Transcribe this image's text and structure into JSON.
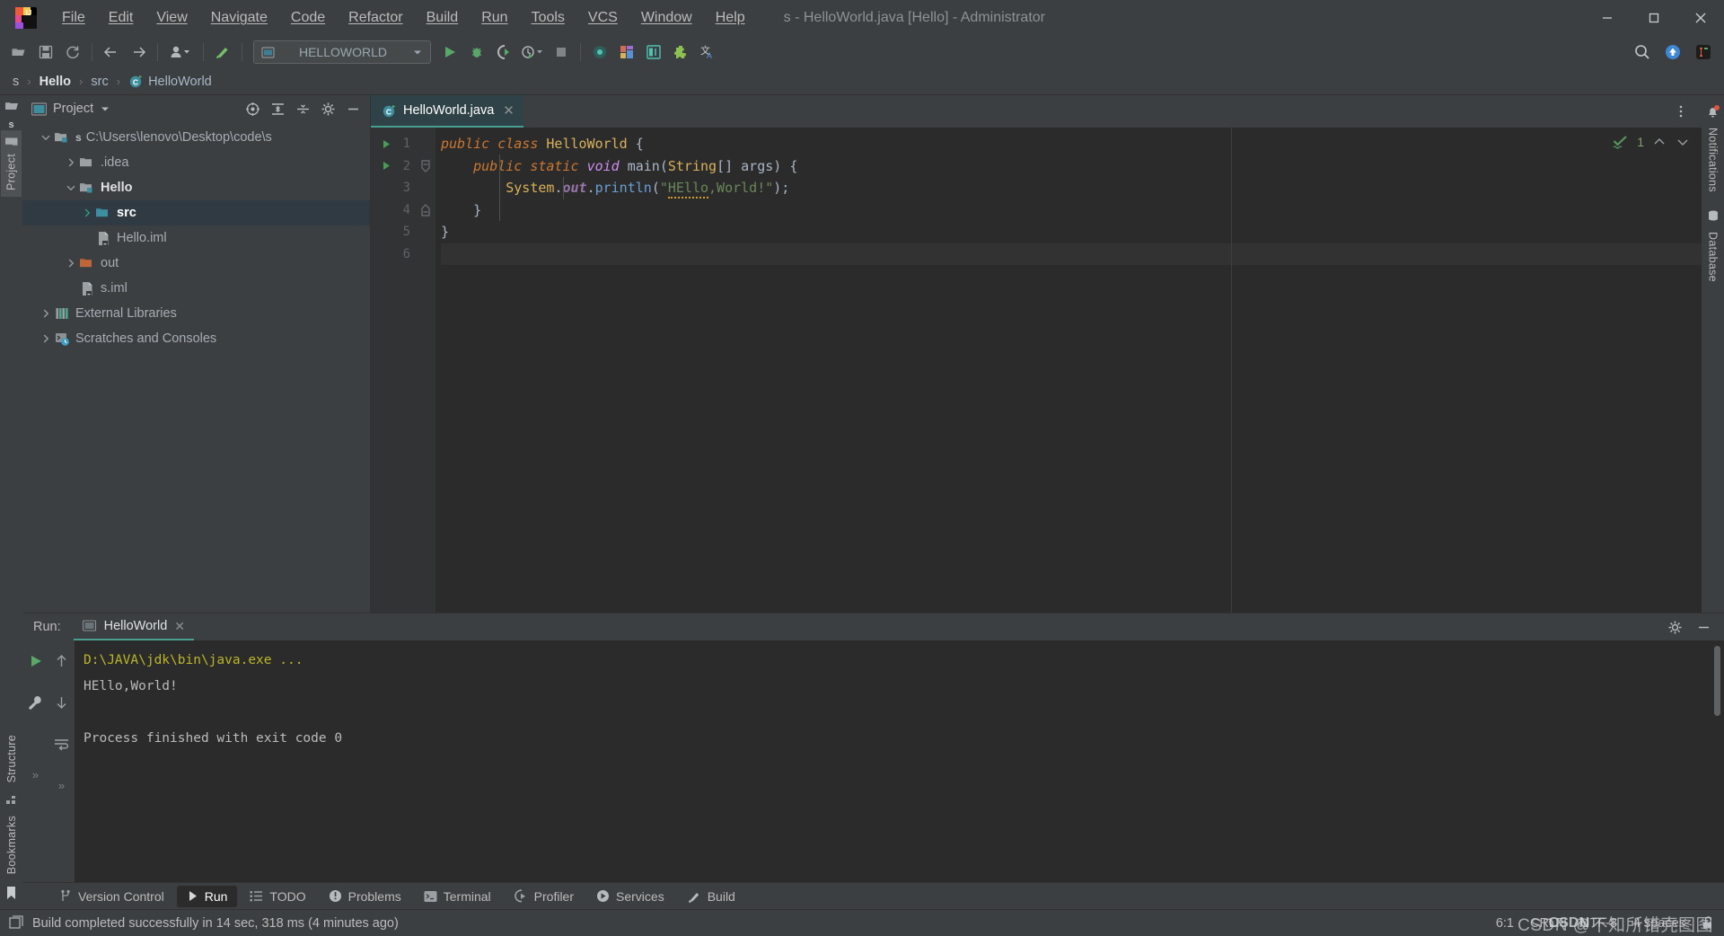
{
  "window": {
    "title": "s - HelloWorld.java [Hello] - Administrator",
    "controls": {
      "minimize": "—",
      "maximize": "❐",
      "close": "✕"
    }
  },
  "menu": {
    "items": [
      {
        "label": "File",
        "mnemonic": "F"
      },
      {
        "label": "Edit",
        "mnemonic": "E"
      },
      {
        "label": "View",
        "mnemonic": "V"
      },
      {
        "label": "Navigate",
        "mnemonic": "N"
      },
      {
        "label": "Code",
        "mnemonic": "C"
      },
      {
        "label": "Refactor",
        "mnemonic": "R"
      },
      {
        "label": "Build",
        "mnemonic": "B"
      },
      {
        "label": "Run",
        "mnemonic": "u"
      },
      {
        "label": "Tools",
        "mnemonic": "T"
      },
      {
        "label": "VCS",
        "mnemonic": "S"
      },
      {
        "label": "Window",
        "mnemonic": "W"
      },
      {
        "label": "Help",
        "mnemonic": "H"
      }
    ]
  },
  "toolbar": {
    "icons": [
      "open-folder-icon",
      "save-all-icon",
      "sync-refresh-icon",
      "navigate-back-icon",
      "navigate-forward-icon",
      "user-account-icon",
      "build-hammer-icon"
    ],
    "run_configuration": "HELLOWORLD",
    "run_config_icon": "module-icon",
    "run_icon": "run-play-icon",
    "debug_icon": "debug-bug-icon",
    "run_coverage_icon": "run-with-coverage-icon",
    "profiler_icon": "profile-clock-icon",
    "stop_icon": "stop-square-icon",
    "right_icons": [
      "search-everywhere-icon",
      "update-arrow-icon",
      "ide-launch-icon"
    ],
    "extra_icons": [
      "database-dot-icon",
      "layout-blocks-icon",
      "inspect-icon",
      "plugin-puzzle-icon",
      "translate-icon"
    ]
  },
  "breadcrumb": {
    "items": [
      {
        "label": "s",
        "type": "project"
      },
      {
        "label": "Hello",
        "type": "module"
      },
      {
        "label": "src",
        "type": "folder"
      },
      {
        "label": "HelloWorld",
        "type": "class"
      }
    ],
    "separator": "›"
  },
  "left_rail": {
    "top_icons": [
      "open-file-icon",
      "project-s-icon"
    ],
    "tabs": [
      {
        "label": "Project",
        "icon": "project-window-icon",
        "active": true
      }
    ],
    "bottom_tabs": [
      {
        "label": "Structure",
        "icon": "structure-icon"
      },
      {
        "label": "Bookmarks",
        "icon": "bookmark-icon"
      }
    ]
  },
  "right_rail": {
    "tabs": [
      {
        "label": "Notifications",
        "icon": "bell-notification-icon",
        "badge": true
      },
      {
        "label": "Database",
        "icon": "database-icon"
      }
    ]
  },
  "project_panel": {
    "title": "Project",
    "title_icon": "project-window-icon",
    "dropdown_icon": "chevron-down-icon",
    "header_actions": [
      "select-opened-file-icon",
      "expand-all-icon",
      "collapse-all-icon",
      "settings-gear-icon",
      "hide-minus-icon"
    ],
    "tree": [
      {
        "label": "C:\\Users\\lenovo\\Desktop\\code\\s",
        "prefix": "s",
        "depth": 0,
        "expanded": true,
        "icon": "module-folder-icon",
        "selected": false,
        "style": "normal"
      },
      {
        "label": ".idea",
        "depth": 1,
        "expanded": false,
        "icon": "folder-icon",
        "selected": false,
        "style": "normal"
      },
      {
        "label": "Hello",
        "depth": 1,
        "expanded": true,
        "icon": "module-folder-icon",
        "selected": false,
        "style": "bold"
      },
      {
        "label": "src",
        "depth": 2,
        "expanded": false,
        "icon": "source-folder-icon",
        "selected": true,
        "style": "white"
      },
      {
        "label": "Hello.iml",
        "depth": 2,
        "expanded": null,
        "icon": "iml-file-icon",
        "selected": false,
        "style": "normal"
      },
      {
        "label": "out",
        "depth": 1,
        "expanded": false,
        "icon": "excluded-folder-icon",
        "selected": false,
        "style": "normal"
      },
      {
        "label": "s.iml",
        "depth": 1,
        "expanded": null,
        "icon": "iml-file-icon",
        "selected": false,
        "style": "normal"
      },
      {
        "label": "External Libraries",
        "depth": 0,
        "expanded": false,
        "icon": "libraries-icon",
        "selected": false,
        "style": "normal"
      },
      {
        "label": "Scratches and Consoles",
        "depth": 0,
        "expanded": false,
        "icon": "scratches-icon",
        "selected": false,
        "style": "normal"
      }
    ]
  },
  "editor": {
    "tabs": [
      {
        "label": "HelloWorld.java",
        "icon": "java-class-icon",
        "active": true,
        "close_icon": "close-icon"
      }
    ],
    "tab_options_icon": "more-vertical-icon",
    "inspection": {
      "status": "ok",
      "count": "1",
      "up_icon": "chevron-up-icon",
      "down_icon": "chevron-down-icon"
    },
    "caret_line": 6,
    "lines": [
      {
        "n": "1",
        "gutter_mark": "run-play-icon",
        "fold": null
      },
      {
        "n": "2",
        "gutter_mark": "run-play-icon",
        "fold": "fold-open-icon"
      },
      {
        "n": "3",
        "gutter_mark": null,
        "fold": null
      },
      {
        "n": "4",
        "gutter_mark": null,
        "fold": "fold-close-icon"
      },
      {
        "n": "5",
        "gutter_mark": null,
        "fold": null
      },
      {
        "n": "6",
        "gutter_mark": null,
        "fold": null
      }
    ],
    "code_text": [
      "public class HelloWorld {",
      "    public static void main(String[] args) {",
      "        System.out.println(\"HEllo,World!\");",
      "    }",
      "}",
      ""
    ]
  },
  "run_panel": {
    "label": "Run:",
    "tab": {
      "label": "HelloWorld",
      "icon": "run-config-icon",
      "close_icon": "close-icon"
    },
    "header_actions": [
      "settings-gear-icon",
      "hide-minus-icon"
    ],
    "sidebar_icons": [
      "rerun-play-icon",
      "up-arrow-icon",
      "wrench-icon",
      "down-arrow-icon",
      "soft-wrap-icon",
      "expand-right-icon",
      "expand-right-2-icon"
    ],
    "console_lines": [
      {
        "text": "D:\\JAVA\\jdk\\bin\\java.exe ...",
        "color": "yellow"
      },
      {
        "text": "HEllo,World!",
        "color": "white"
      },
      {
        "text": "",
        "color": "white"
      },
      {
        "text": "Process finished with exit code 0",
        "color": "gray"
      }
    ]
  },
  "bottom_tabs": [
    {
      "label": "Version Control",
      "icon": "branch-icon",
      "active": false
    },
    {
      "label": "Run",
      "icon": "run-play-icon",
      "active": true
    },
    {
      "label": "TODO",
      "icon": "todo-list-icon",
      "active": false
    },
    {
      "label": "Problems",
      "icon": "problems-icon",
      "active": false
    },
    {
      "label": "Terminal",
      "icon": "terminal-icon",
      "active": false
    },
    {
      "label": "Profiler",
      "icon": "profiler-icon",
      "active": false
    },
    {
      "label": "Services",
      "icon": "services-icon",
      "active": false
    },
    {
      "label": "Build",
      "icon": "build-hammer-icon",
      "active": false
    }
  ],
  "status_bar": {
    "icon": "event-log-icon",
    "message": "Build completed successfully in 14 sec, 318 ms (4 minutes ago)",
    "caret_position": "6:1",
    "line_separator": "CRLF",
    "encoding": "UTF-8",
    "indent": "4 spaces",
    "lock_icon": "unlocked-icon",
    "watermark": "CSDN @不知所错壳图图"
  },
  "colors": {
    "accent_teal": "#4a9e8f",
    "panel_bg": "#3c3f41",
    "editor_bg": "#2b2b2b",
    "gutter_bg": "#313335",
    "selection": "#2f3a42",
    "text": "#bbbbbb",
    "keyword": "#cc7832",
    "string": "#6a8759",
    "type": "#d9b15a",
    "method": "#6a9fd4",
    "console_yellow": "#bbb529",
    "green_run": "#499c54",
    "orange_folder": "#c1663a"
  }
}
